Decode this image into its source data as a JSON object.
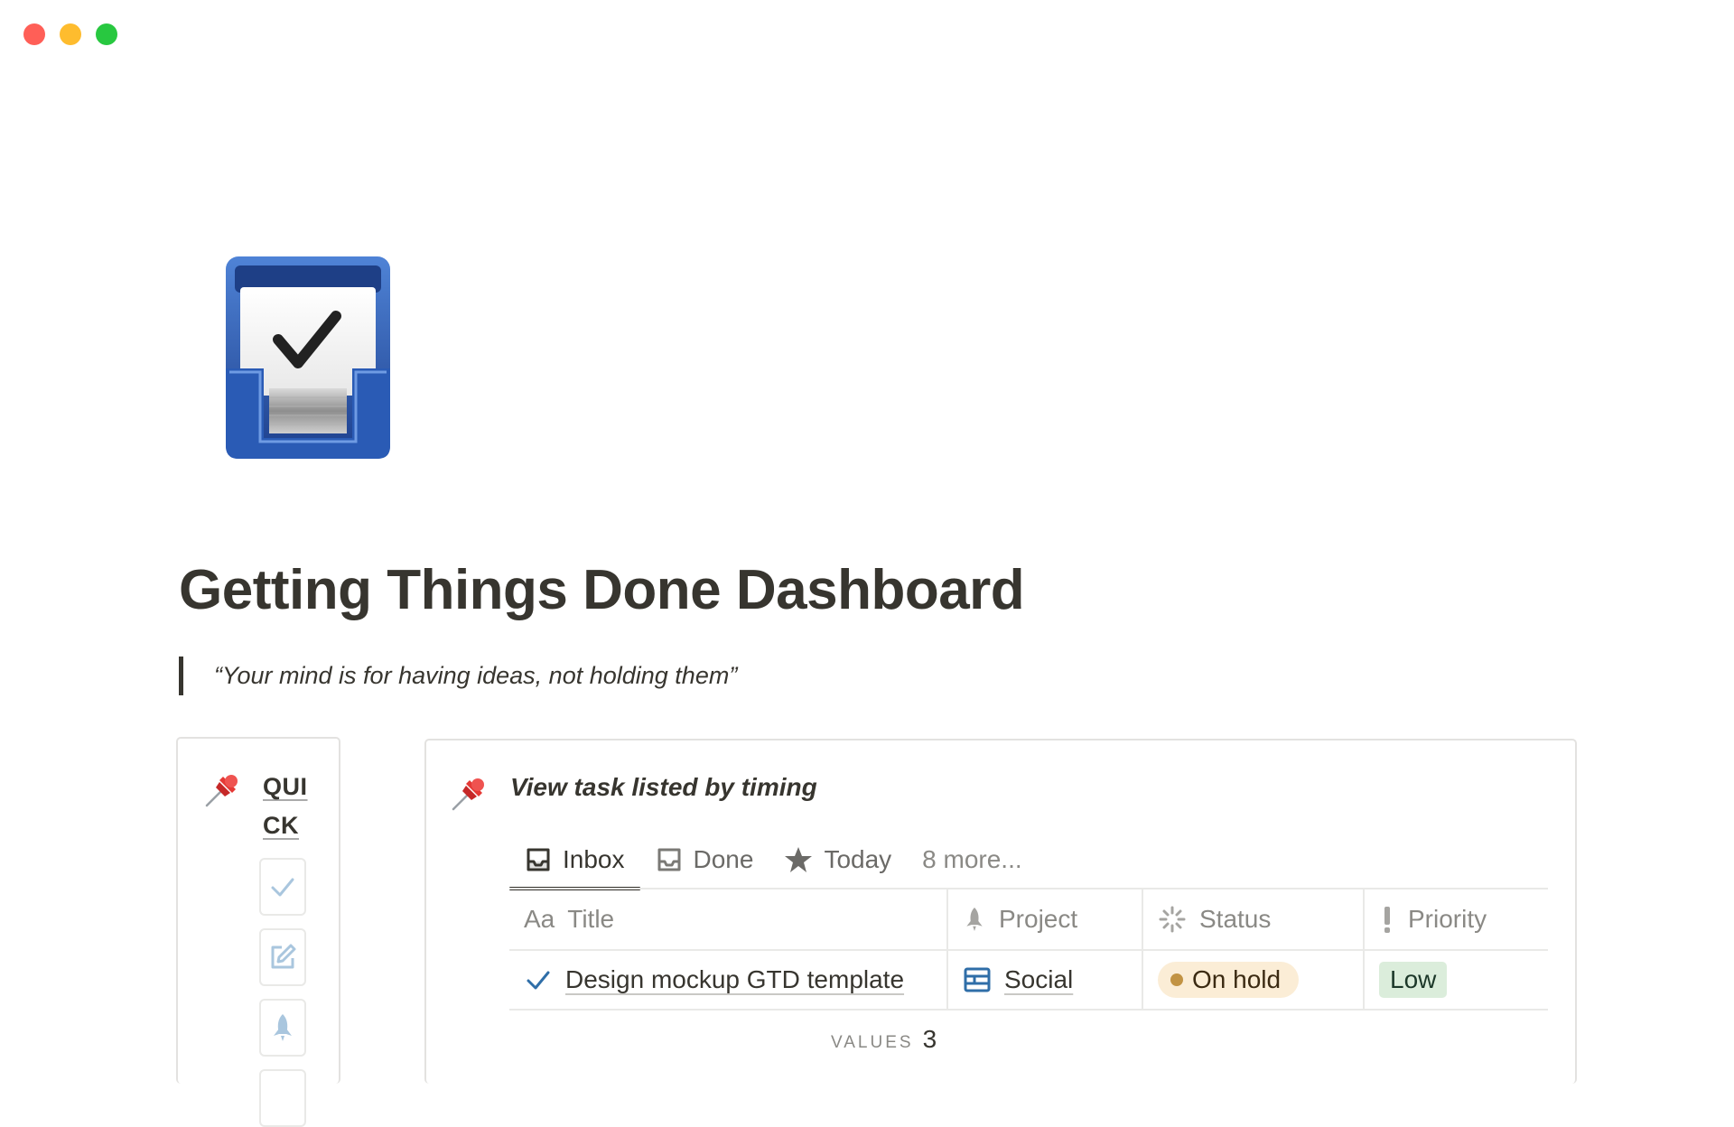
{
  "page": {
    "title": "Getting Things Done Dashboard",
    "quote": "“Your mind is for having ideas, not holding them”"
  },
  "quick_panel": {
    "label": "QUICK",
    "buttons": [
      {
        "name": "check-icon"
      },
      {
        "name": "edit-icon"
      },
      {
        "name": "rocket-icon"
      }
    ]
  },
  "task_view": {
    "title": "View task listed by timing",
    "tabs": [
      {
        "label": "Inbox",
        "icon": "inbox-icon",
        "active": true
      },
      {
        "label": "Done",
        "icon": "tray-icon",
        "active": false
      },
      {
        "label": "Today",
        "icon": "star-icon",
        "active": false
      }
    ],
    "more_tabs": "8 more...",
    "columns": [
      {
        "label": "Title",
        "icon_text": "Aa"
      },
      {
        "label": "Project",
        "icon": "rocket-icon"
      },
      {
        "label": "Status",
        "icon": "loading-icon"
      },
      {
        "label": "Priority",
        "icon": "exclamation-icon"
      }
    ],
    "rows": [
      {
        "title": "Design mockup GTD template",
        "project": "Social",
        "status": "On hold",
        "priority": "Low"
      }
    ],
    "footer": {
      "label": "VALUES",
      "count": "3"
    }
  },
  "colors": {
    "status_on_hold_bg": "#fbedd6",
    "status_on_hold_dot": "#c29343",
    "priority_low_bg": "#dbeddb",
    "priority_low_text": "#1c3829",
    "check_blue": "#2f6ea8",
    "project_icon_blue": "#2f6ea8",
    "quick_icon_blue": "#a9c6de"
  }
}
